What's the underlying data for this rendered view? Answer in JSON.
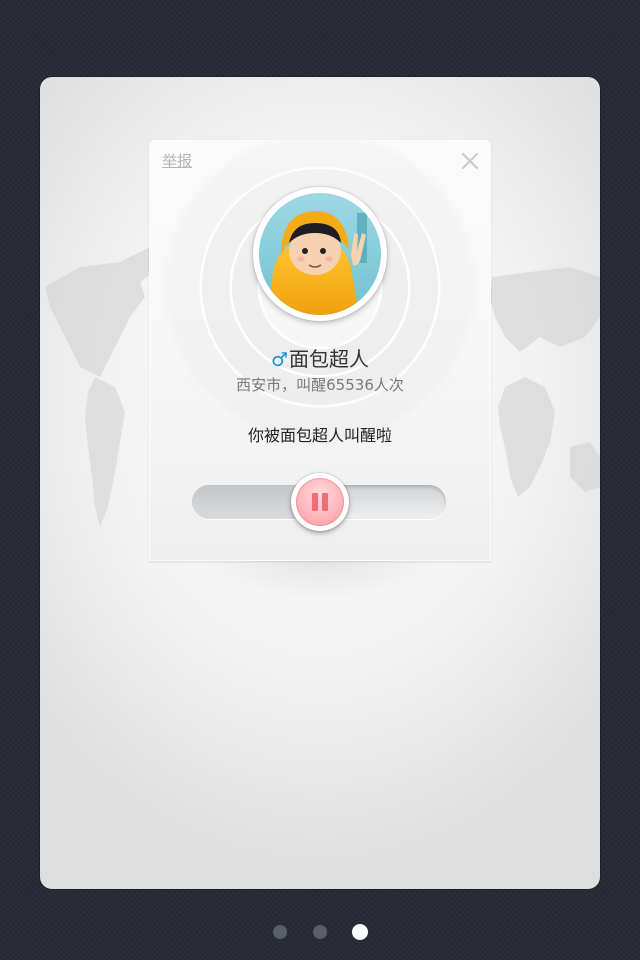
{
  "dialog": {
    "report_label": "举报",
    "close_icon": "close-icon",
    "avatar_icon": "user-avatar",
    "gender_symbol": "♂",
    "gender_color": "#1f8fd6",
    "name": "面包超人",
    "info": "西安市，叫醒65536人次",
    "message": "你被面包超人叫醒啦",
    "pause_icon": "pause-icon",
    "accent_color": "#ef6d77",
    "progress": 0.5
  },
  "pager": {
    "count": 3,
    "active_index": 2
  }
}
